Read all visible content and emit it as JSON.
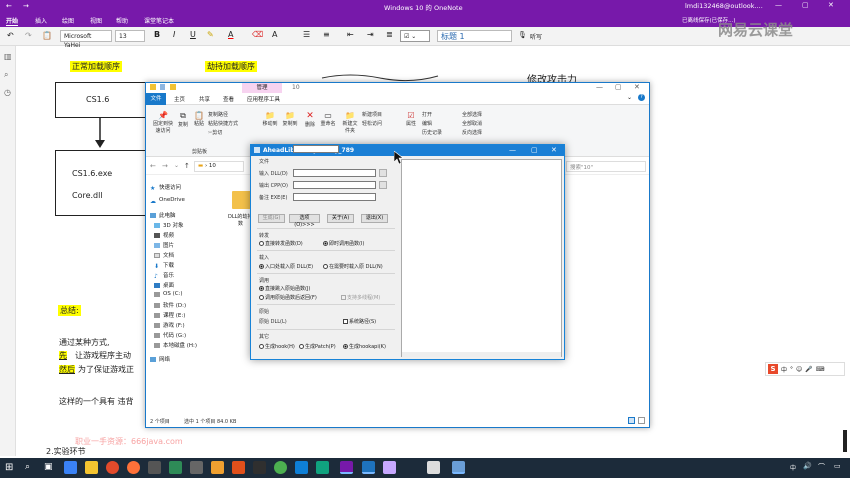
{
  "onenote": {
    "window_title": "Windows 10 的 OneNote",
    "account": "lmdi132468@outlook....",
    "tabs": [
      "开始",
      "插入",
      "绘图",
      "视图",
      "帮助",
      "课堂笔记本"
    ],
    "sync_status": "已离线保存(已保存...)",
    "font_name": "Microsoft YaHei",
    "font_size": "13",
    "style": "标题 1",
    "listen": "听写",
    "brand": "网易云课堂"
  },
  "note": {
    "label_normal": "正常加载顺序",
    "label_hijack": "劫持加载顺序",
    "box_top": "CS1.6",
    "box_exe": "CS1.6.exe",
    "box_dll": "Core.dll",
    "heading_modify": "修改攻击力",
    "summary_label": "总结:",
    "line1": "通过某种方式,",
    "line2_hl": "先",
    "line2": "让游戏程序主动",
    "line3_hl": "然后",
    "line3": "为了保证游戏正",
    "line4": "这样的一个具有 违背",
    "watermark": "职业一手资源：666java.com",
    "section2": "2.实验环节"
  },
  "explorer": {
    "title_tab": "管理",
    "title_num": "10",
    "tabs": [
      "文件",
      "主页",
      "共享",
      "查看",
      "应用程序工具"
    ],
    "ribbon": {
      "pin": "固定到快速访问",
      "copy": "复制",
      "paste": "粘贴",
      "copy_path": "复制路径",
      "paste_shortcut": "粘贴快捷方式",
      "cut": "剪切",
      "clipboard": "剪贴板",
      "move_to": "移动到",
      "copy_to": "复制到",
      "delete": "删除",
      "rename": "重命名",
      "new_folder": "新建文件夹",
      "new_item": "新建项目",
      "easy_access": "轻松访问",
      "properties": "属性",
      "open": "打开",
      "edit": "编辑",
      "history": "历史记录",
      "select_all": "全部选择",
      "select_none": "全部取消",
      "invert": "反向选择"
    },
    "address": "10",
    "search_placeholder": "搜索\"10\"",
    "nav": [
      "快速访问",
      "OneDrive",
      "此电脑",
      "3D 对象",
      "视频",
      "图片",
      "文档",
      "下载",
      "音乐",
      "桌面",
      "OS (C:)",
      "软件 (D:)",
      "课程 (E:)",
      "游戏 (F:)",
      "代码 (G:)",
      "本地磁盘 (H:)",
      "网络"
    ],
    "file_label": "DLL的劫持",
    "file_label2": "数",
    "status_items": "2 个项目",
    "status_selected": "选中 1 个项目 84.0 KB"
  },
  "dialog": {
    "title": "AheadLib Fix by Lucky_789",
    "group_file": "文件",
    "input_label": "输入 DLL(D)",
    "output_label": "输出 CPP(O)",
    "backup_label": "备注 EXE(E)",
    "btn_generate": "生成(G)",
    "btn_options": "选项(O)>>>",
    "btn_about": "关于(A)",
    "btn_exit": "退出(X)",
    "group_forward": "转发",
    "fwd_direct": "直接转发函数(D)",
    "fwd_call": "即时调用函数(I)",
    "group_load": "载入",
    "load_entry": "入口处载入原 DLL(E)",
    "load_need": "在需要时载入原 DLL(N)",
    "group_call": "调用",
    "call_direct": "直接跳入原始函数(J)",
    "call_after": "调用原始函数后返回(F)",
    "call_multi": "支持多线程(M)",
    "group_orig": "原始",
    "orig_label": "原始 DLL(L)",
    "orig_sys": "系统路径(S)",
    "group_other": "其它",
    "other_1": "生成hook(H)",
    "other_2": "生成Patch(P)",
    "other_3": "生成hookapi(K)"
  },
  "taskbar": {
    "time": "",
    "ime": "中"
  },
  "colors": {
    "onenote_purple": "#7719aa",
    "dialog_blue": "#1a7fd5",
    "highlight": "#ffff00"
  }
}
